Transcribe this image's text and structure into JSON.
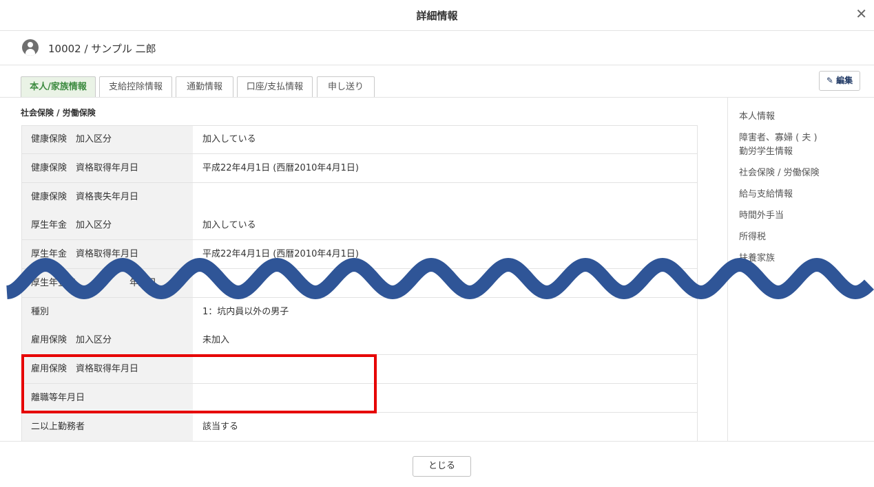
{
  "header": {
    "title": "詳細情報",
    "close_icon": "✕"
  },
  "employee": {
    "name": "10002 / サンプル 二郎"
  },
  "tabs": [
    {
      "label": "本人/家族情報"
    },
    {
      "label": "支給控除情報"
    },
    {
      "label": "通勤情報"
    },
    {
      "label": "口座/支払情報"
    },
    {
      "label": "申し送り"
    }
  ],
  "toolbar": {
    "edit_label": "編集",
    "edit_icon": "✎"
  },
  "section": {
    "title": "社会保険 / 労働保険"
  },
  "rows": [
    {
      "label": "健康保険　加入区分",
      "value": "加入している"
    },
    {
      "label": "健康保険　資格取得年月日",
      "value": "平成22年4月1日 (西暦2010年4月1日)"
    },
    {
      "label": "健康保険　資格喪失年月日",
      "value": ""
    },
    {
      "label": "厚生年金　加入区分",
      "value": "加入している"
    },
    {
      "label": "厚生年金　資格取得年月日",
      "value": "平成22年4月1日 (西暦2010年4月1日)"
    },
    {
      "label": "厚生年金基　　　　　　年月日",
      "value": ""
    },
    {
      "label": "種別",
      "value": "1：坑内員以外の男子"
    },
    {
      "label": "雇用保険　加入区分",
      "value": "未加入"
    },
    {
      "label": "雇用保険　資格取得年月日",
      "value": ""
    },
    {
      "label": "離職等年月日",
      "value": ""
    },
    {
      "label": "二以上勤務者",
      "value": "該当する"
    }
  ],
  "side_nav": [
    {
      "label": "本人情報"
    },
    {
      "label": "障害者、寡婦 ( 夫 ) 勤労学生情報"
    },
    {
      "label": "社会保険 / 労働保険"
    },
    {
      "label": "給与支給情報"
    },
    {
      "label": "時間外手当"
    },
    {
      "label": "所得税"
    },
    {
      "label": "扶養家族"
    }
  ],
  "footer": {
    "close_label": "とじる"
  },
  "colors": {
    "active_tab": "#3d8b40",
    "wave": "#2f5597",
    "highlight": "#e60000",
    "edit_text": "#1f3864"
  }
}
